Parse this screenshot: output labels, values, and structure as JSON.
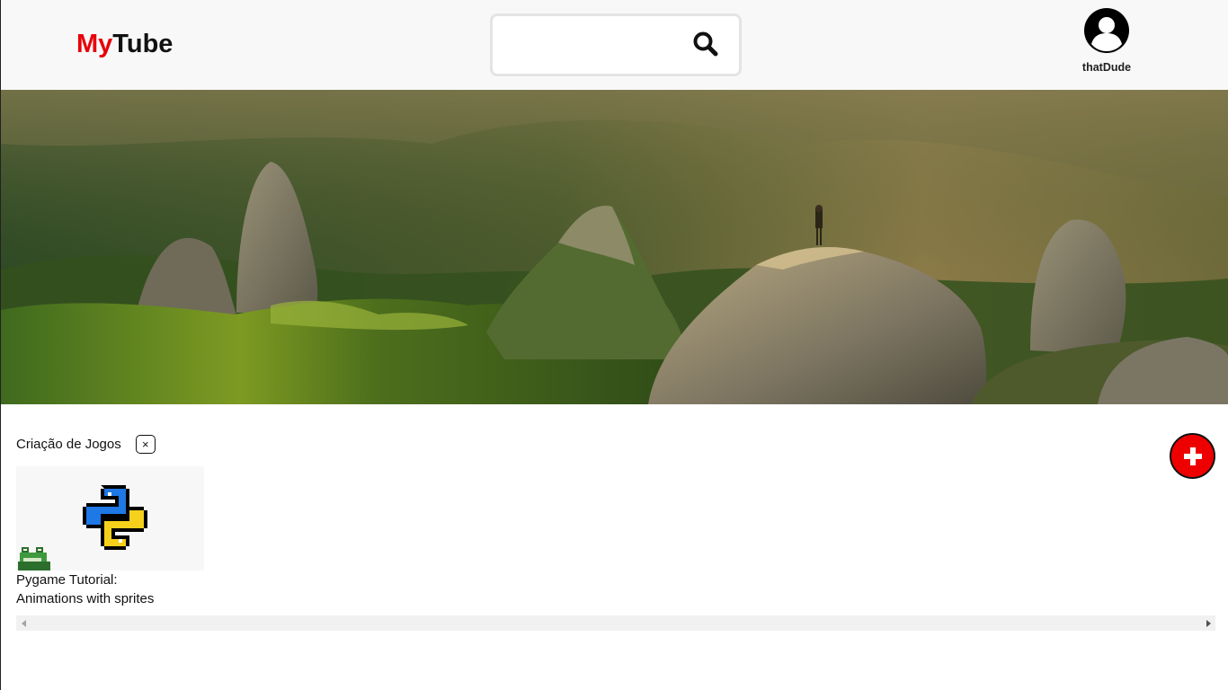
{
  "app": {
    "logo_my": "My",
    "logo_tube": "Tube"
  },
  "search": {
    "value": "",
    "placeholder": ""
  },
  "user": {
    "username": "thatDude"
  },
  "playlist": {
    "title": "Criação de Jogos",
    "remove_label": "×",
    "videos": [
      {
        "title_line1": "Pygame Tutorial:",
        "title_line2": "Animations with sprites"
      }
    ]
  },
  "icons": {
    "search": "search-icon",
    "avatar": "user-avatar-icon",
    "remove": "close-icon",
    "add": "plus-icon",
    "scroll_left": "chevron-left-icon",
    "scroll_right": "chevron-right-icon"
  },
  "colors": {
    "brand": "#e8000a",
    "header_bg": "#f8f8f8",
    "add_button": "#ee0000"
  }
}
